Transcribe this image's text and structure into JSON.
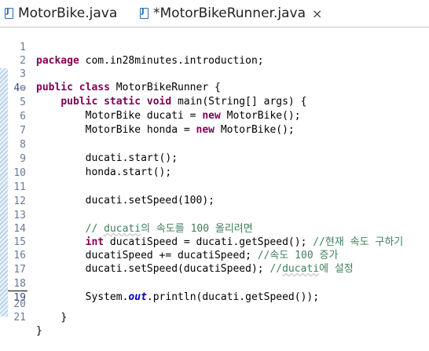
{
  "tabs": [
    {
      "label": "MotorBike.java"
    },
    {
      "label": "*MotorBikeRunner.java",
      "close": "×"
    }
  ],
  "lines": [
    {
      "n": "1"
    },
    {
      "n": "2"
    },
    {
      "n": "3"
    },
    {
      "n": "4⊖"
    },
    {
      "n": "5"
    },
    {
      "n": "6"
    },
    {
      "n": "7"
    },
    {
      "n": "8"
    },
    {
      "n": "9"
    },
    {
      "n": "10"
    },
    {
      "n": "11"
    },
    {
      "n": "12"
    },
    {
      "n": "13"
    },
    {
      "n": "14"
    },
    {
      "n": "15"
    },
    {
      "n": "16"
    },
    {
      "n": "17"
    },
    {
      "n": "18"
    },
    {
      "n": "19"
    },
    {
      "n": "20"
    },
    {
      "n": "21"
    }
  ],
  "code": {
    "l1_kw": "package",
    "l1_rest": " com.in28minutes.introduction;",
    "l3_kw1": "public",
    "l3_kw2": "class",
    "l3_rest": " MotorBikeRunner {",
    "l4_kw1": "public",
    "l4_kw2": "static",
    "l4_kw3": "void",
    "l4_rest": " main(String[] args) {",
    "l5_a": "MotorBike ducati = ",
    "l5_kw": "new",
    "l5_b": " MotorBike();",
    "l6_a": "MotorBike honda = ",
    "l6_kw": "new",
    "l6_b": " MotorBike();",
    "l8": "ducati.start();",
    "l9": "honda.start();",
    "l11": "ducati.setSpeed(100);",
    "l13_a": "// ",
    "l13_sq": "ducati",
    "l13_b": "의 속도를 100 올리려면",
    "l14_kw": "int",
    "l14_a": " ducatiSpeed = ducati.getSpeed(); ",
    "l14_cm": "//현재 속도 구하기",
    "l15_a": "ducatiSpeed += ducatiSpeed; ",
    "l15_cm": "//속도 100 증가",
    "l16_a": "ducati.setSpeed(ducatiSpeed); ",
    "l16_cm1": "//",
    "l16_sq": "ducati",
    "l16_cm2": "에 설정",
    "l18_a": "System.",
    "l18_it": "out",
    "l18_b": ".println(ducati.getSpeed());",
    "l20": "}",
    "l21": "}"
  }
}
